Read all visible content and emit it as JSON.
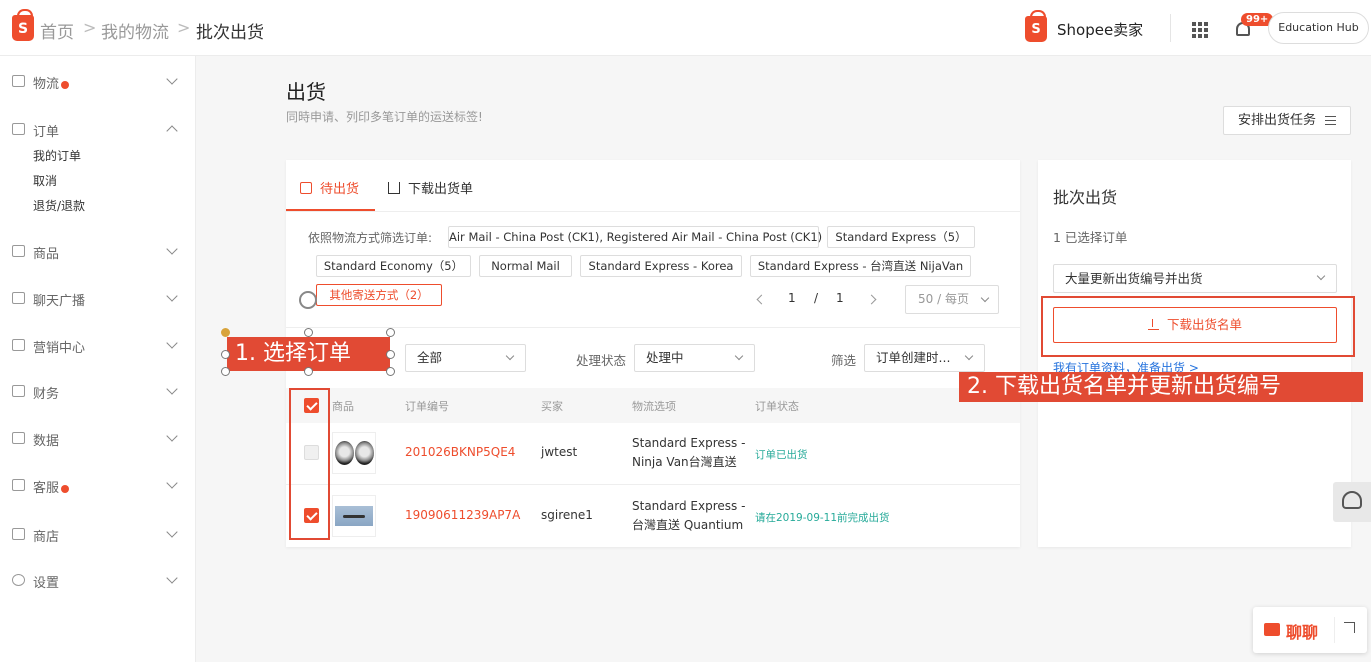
{
  "header": {
    "breadcrumb": [
      "首页",
      "我的物流",
      "批次出货"
    ],
    "brand": "Shopee卖家",
    "notification_count": "99+",
    "education_hub": "Education Hub",
    "logo_letter": "S"
  },
  "sidebar": {
    "items": [
      {
        "label": "物流",
        "icon": "truck-icon",
        "dot": true
      },
      {
        "label": "订单",
        "icon": "clipboard-icon",
        "expanded": true,
        "sub": [
          "我的订单",
          "取消",
          "退货/退款"
        ]
      },
      {
        "label": "商品",
        "icon": "box-icon"
      },
      {
        "label": "聊天广播",
        "icon": "broadcast-icon"
      },
      {
        "label": "营销中心",
        "icon": "tag-icon"
      },
      {
        "label": "财务",
        "icon": "wallet-icon"
      },
      {
        "label": "数据",
        "icon": "chart-icon"
      },
      {
        "label": "客服",
        "icon": "chat-icon",
        "dot": true
      },
      {
        "label": "商店",
        "icon": "store-icon"
      },
      {
        "label": "设置",
        "icon": "gear-icon"
      }
    ]
  },
  "page": {
    "title": "出货",
    "description": "同時申请、列印多笔订单的运送标签!",
    "arrange_button": "安排出货任务"
  },
  "tabs": [
    {
      "label": "待出货",
      "active": true,
      "icon": "package-icon"
    },
    {
      "label": "下载出货单",
      "active": false,
      "icon": "download-icon"
    }
  ],
  "filter": {
    "label": "依照物流方式筛选订单:",
    "chips": [
      "Air Mail - China Post (CK1), Registered Air Mail - China Post (CK1)",
      "Standard Express（5）",
      "Standard Economy（5）",
      "Normal Mail",
      "Standard Express - Korea",
      "Standard Express - 台湾直送 NijaVan",
      "其他寄送方式（2）"
    ]
  },
  "pagination": {
    "current": "1",
    "separator": "/",
    "total": "1",
    "per_page": "50 / 每页"
  },
  "controls": {
    "all_select": "全部",
    "status_label": "处理状态",
    "status_value": "处理中",
    "filter_label": "筛选",
    "filter_value": "订单创建时..."
  },
  "table": {
    "headers": [
      "商品",
      "订单编号",
      "买家",
      "物流选项",
      "订单状态"
    ],
    "rows": [
      {
        "order_id": "201026BKNP5QE4",
        "buyer": "jwtest",
        "logistics": [
          "Standard Express -",
          "Ninja Van台灣直送"
        ],
        "status": "订单已出货",
        "checked": false,
        "disabled": true
      },
      {
        "order_id": "19090611239AP7A",
        "buyer": "sgirene1",
        "logistics": [
          "Standard Express -",
          "台灣直送 Quantium"
        ],
        "status": "请在2019-09-11前完成出货",
        "checked": true,
        "disabled": false
      }
    ]
  },
  "batch_panel": {
    "title": "批次出货",
    "selected": "1 已选择订单",
    "dropdown": "大量更新出货编号并出货",
    "download_button": "下载出货名单",
    "link": "我有订单资料，准备出货 >"
  },
  "annotations": {
    "step1": "1. 选择订单",
    "step2": "2. 下载出货名单并更新出货编号"
  },
  "chat": {
    "label": "聊聊"
  },
  "colors": {
    "accent": "#ee4d2d",
    "annotation": "#e14a34",
    "status_green": "#26aa99",
    "link_blue": "#2673dd"
  }
}
